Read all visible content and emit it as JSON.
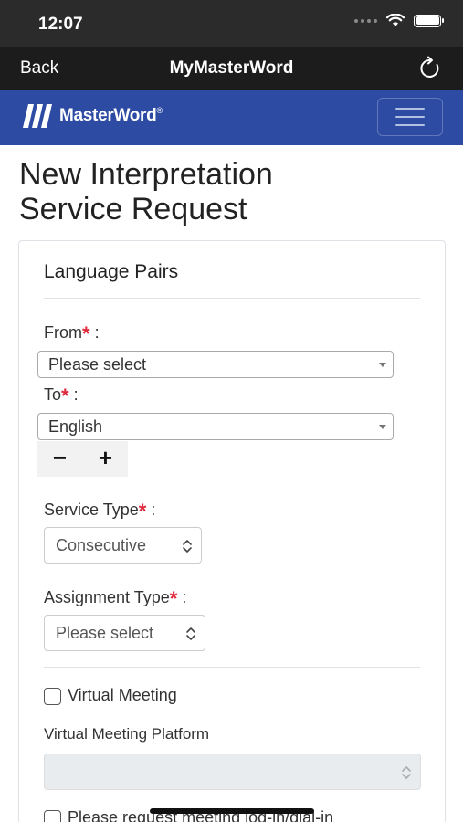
{
  "status_bar": {
    "time": "12:07"
  },
  "nav": {
    "back_label": "Back",
    "title": "MyMasterWord",
    "refresh_icon": "refresh-icon"
  },
  "brand": {
    "logo_text": "MasterWord",
    "registered_mark": "®",
    "menu_icon": "hamburger-menu-icon",
    "bar_color": "#2d4ba3"
  },
  "page": {
    "title_line1": "New Interpretation",
    "title_line2": "Service Request"
  },
  "language_pairs": {
    "heading": "Language Pairs",
    "from_label": "From",
    "from_value": "Please select",
    "to_label": "To",
    "to_value": "English",
    "remove_label": "−",
    "add_label": "+"
  },
  "service_type": {
    "label": "Service Type",
    "value": "Consecutive"
  },
  "assignment_type": {
    "label": "Assignment Type",
    "value": "Please select"
  },
  "virtual_meeting": {
    "checkbox_label": "Virtual Meeting",
    "platform_label": "Virtual Meeting Platform",
    "platform_value": "",
    "request_login_label": "Please request meeting log-in/dial-in"
  },
  "required_marker": "*",
  "label_colon": ":",
  "colors": {
    "required": "#e0283a",
    "nav_bg": "#1c1c1c",
    "status_bg": "#2b2b2b"
  }
}
